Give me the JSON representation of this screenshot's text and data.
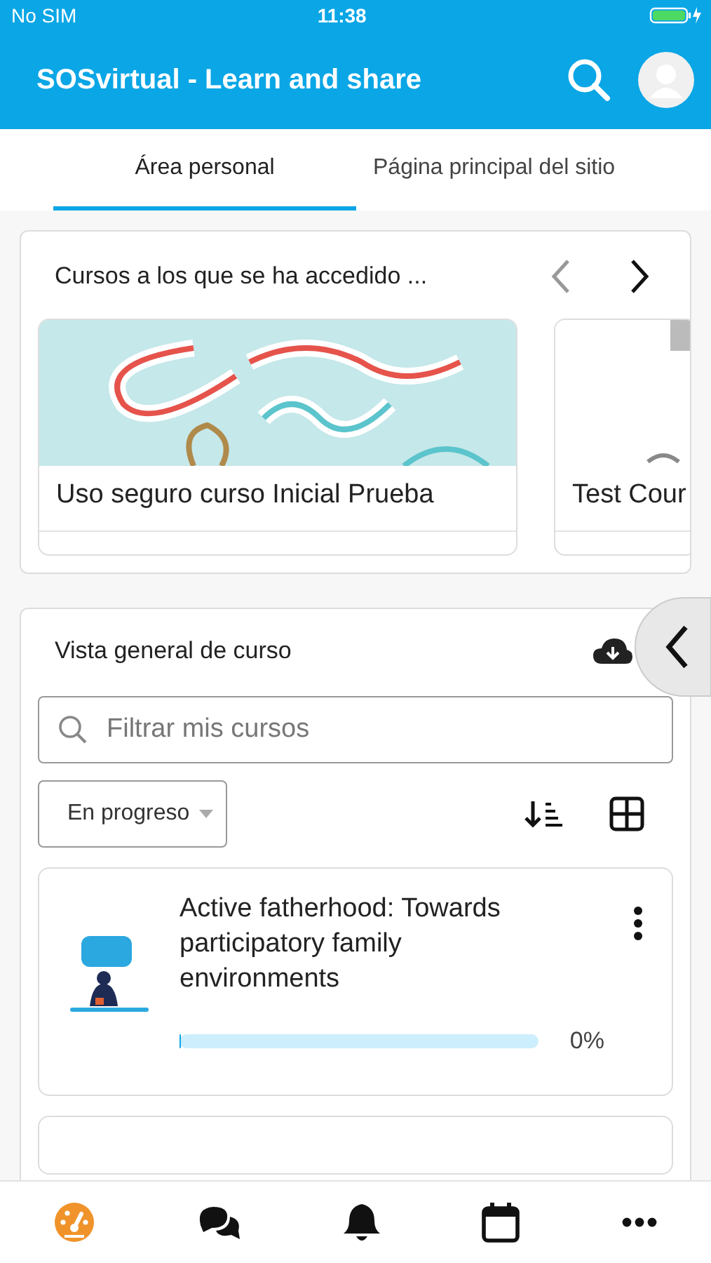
{
  "status_bar": {
    "carrier": "No SIM",
    "time": "11:38"
  },
  "header": {
    "title": "SOSvirtual - Learn and share"
  },
  "tabs": [
    {
      "label": "Área personal",
      "selected": true
    },
    {
      "label": "Página principal del sitio",
      "selected": false
    }
  ],
  "recent_courses": {
    "title": "Cursos a los que se ha accedido ...",
    "prev_disabled": true,
    "next_disabled": false,
    "courses": [
      {
        "name": "Uso seguro curso Inicial Prueba",
        "kind": "picture"
      },
      {
        "name": "Test Cour",
        "kind": "loading"
      }
    ]
  },
  "overview": {
    "title": "Vista general de curso",
    "search": {
      "placeholder": "Filtrar mis cursos"
    },
    "filter": "En progreso",
    "courses": [
      {
        "name": "Active fatherhood: Towards participatory family environments",
        "level": 0,
        "reading": "0%"
      },
      {
        "partial": true
      }
    ]
  },
  "bottom_nav": [
    {
      "selected": true
    },
    {
      "selected": false
    },
    {
      "selected": false
    },
    {
      "selected": false
    },
    {
      "selected": false
    }
  ]
}
